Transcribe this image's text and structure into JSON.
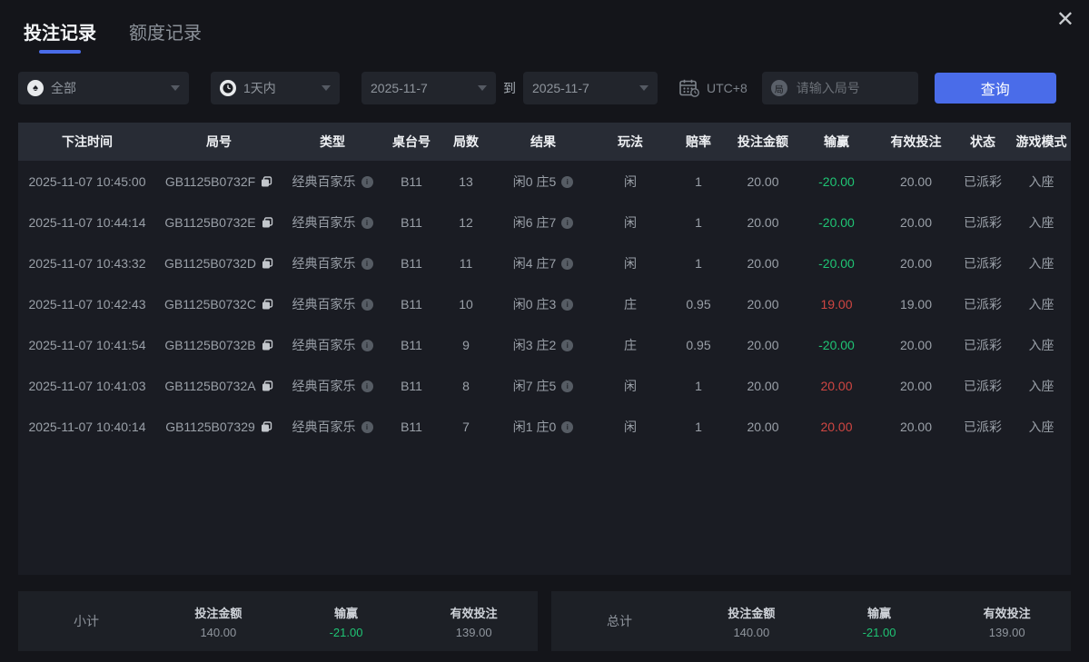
{
  "window": {
    "close_label": "✕"
  },
  "tabs": {
    "bet_records": "投注记录",
    "quota_records": "额度记录"
  },
  "icons": {
    "game_type_char": "♠",
    "round_char": "局"
  },
  "filters": {
    "game_type_value": "全部",
    "time_range_value": "1天内",
    "date_from": "2025-11-7",
    "to_label": "到",
    "date_to": "2025-11-7",
    "timezone": "UTC+8",
    "round_placeholder": "请输入局号",
    "search_label": "查询"
  },
  "table": {
    "columns": [
      "下注时间",
      "局号",
      "类型",
      "桌台号",
      "局数",
      "结果",
      "玩法",
      "赔率",
      "投注金额",
      "输赢",
      "有效投注",
      "状态",
      "游戏模式"
    ],
    "rows": [
      {
        "time": "2025-11-07 10:45:00",
        "round_id": "GB1125B0732F",
        "type": "经典百家乐",
        "table_no": "B11",
        "round_no": "13",
        "result": "闲0 庄5",
        "play": "闲",
        "odds": "1",
        "bet": "20.00",
        "win_loss": "-20.00",
        "valid_bet": "20.00",
        "status": "已派彩",
        "mode": "入座"
      },
      {
        "time": "2025-11-07 10:44:14",
        "round_id": "GB1125B0732E",
        "type": "经典百家乐",
        "table_no": "B11",
        "round_no": "12",
        "result": "闲6 庄7",
        "play": "闲",
        "odds": "1",
        "bet": "20.00",
        "win_loss": "-20.00",
        "valid_bet": "20.00",
        "status": "已派彩",
        "mode": "入座"
      },
      {
        "time": "2025-11-07 10:43:32",
        "round_id": "GB1125B0732D",
        "type": "经典百家乐",
        "table_no": "B11",
        "round_no": "11",
        "result": "闲4 庄7",
        "play": "闲",
        "odds": "1",
        "bet": "20.00",
        "win_loss": "-20.00",
        "valid_bet": "20.00",
        "status": "已派彩",
        "mode": "入座"
      },
      {
        "time": "2025-11-07 10:42:43",
        "round_id": "GB1125B0732C",
        "type": "经典百家乐",
        "table_no": "B11",
        "round_no": "10",
        "result": "闲0 庄3",
        "play": "庄",
        "odds": "0.95",
        "bet": "20.00",
        "win_loss": "19.00",
        "valid_bet": "19.00",
        "status": "已派彩",
        "mode": "入座"
      },
      {
        "time": "2025-11-07 10:41:54",
        "round_id": "GB1125B0732B",
        "type": "经典百家乐",
        "table_no": "B11",
        "round_no": "9",
        "result": "闲3 庄2",
        "play": "庄",
        "odds": "0.95",
        "bet": "20.00",
        "win_loss": "-20.00",
        "valid_bet": "20.00",
        "status": "已派彩",
        "mode": "入座"
      },
      {
        "time": "2025-11-07 10:41:03",
        "round_id": "GB1125B0732A",
        "type": "经典百家乐",
        "table_no": "B11",
        "round_no": "8",
        "result": "闲7 庄5",
        "play": "闲",
        "odds": "1",
        "bet": "20.00",
        "win_loss": "20.00",
        "valid_bet": "20.00",
        "status": "已派彩",
        "mode": "入座"
      },
      {
        "time": "2025-11-07 10:40:14",
        "round_id": "GB1125B07329",
        "type": "经典百家乐",
        "table_no": "B11",
        "round_no": "7",
        "result": "闲1 庄0",
        "play": "闲",
        "odds": "1",
        "bet": "20.00",
        "win_loss": "20.00",
        "valid_bet": "20.00",
        "status": "已派彩",
        "mode": "入座"
      }
    ]
  },
  "summary": {
    "subtotal": {
      "label": "小计",
      "bet_label": "投注金额",
      "bet_value": "140.00",
      "win_loss_label": "输赢",
      "win_loss_value": "-21.00",
      "valid_label": "有效投注",
      "valid_value": "139.00"
    },
    "total": {
      "label": "总计",
      "bet_label": "投注金额",
      "bet_value": "140.00",
      "win_loss_label": "输赢",
      "win_loss_value": "-21.00",
      "valid_label": "有效投注",
      "valid_value": "139.00"
    }
  },
  "colors": {
    "accent": "#4a6ce9",
    "win_red": "#d04642",
    "loss_green": "#1fc474"
  }
}
